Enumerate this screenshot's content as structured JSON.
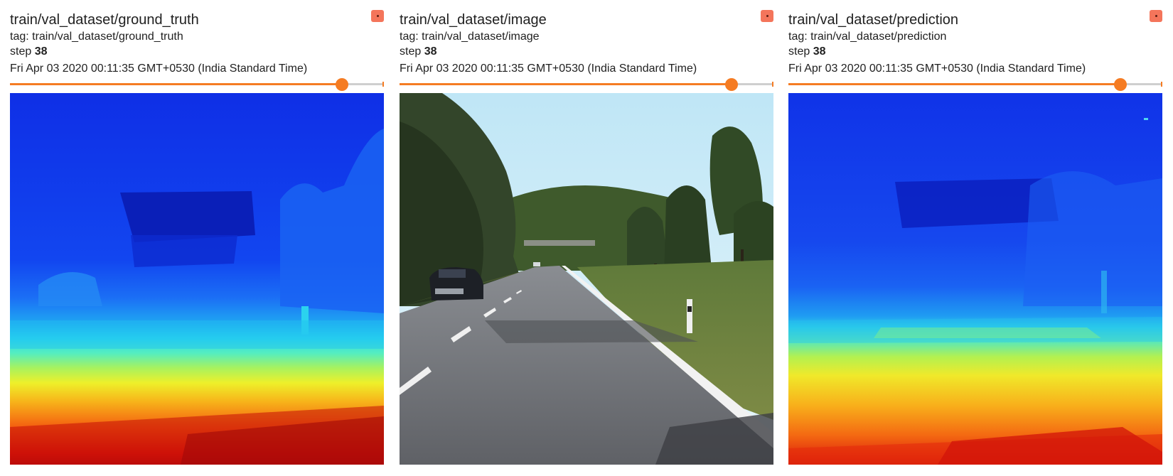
{
  "step_label": "step",
  "cards": [
    {
      "title": "train/val_dataset/ground_truth",
      "tag": "tag: train/val_dataset/ground_truth",
      "step": "38",
      "wall_time": "Fri Apr 03 2020 00:11:35 GMT+0530 (India Standard Time)",
      "slider_fraction": 0.888,
      "expand_icon": "expand-icon",
      "image_kind": "depth-colormap-jet"
    },
    {
      "title": "train/val_dataset/image",
      "tag": "tag: train/val_dataset/image",
      "step": "38",
      "wall_time": "Fri Apr 03 2020 00:11:35 GMT+0530 (India Standard Time)",
      "slider_fraction": 0.888,
      "expand_icon": "expand-icon",
      "image_kind": "rgb-road-scene"
    },
    {
      "title": "train/val_dataset/prediction",
      "tag": "tag: train/val_dataset/prediction",
      "step": "38",
      "wall_time": "Fri Apr 03 2020 00:11:35 GMT+0530 (India Standard Time)",
      "slider_fraction": 0.888,
      "expand_icon": "expand-icon",
      "image_kind": "depth-colormap-jet"
    }
  ],
  "colors": {
    "accent": "#f57c23",
    "expand_button": "#f4755b",
    "slider_rail": "#cfcfcf",
    "text": "#212121"
  }
}
